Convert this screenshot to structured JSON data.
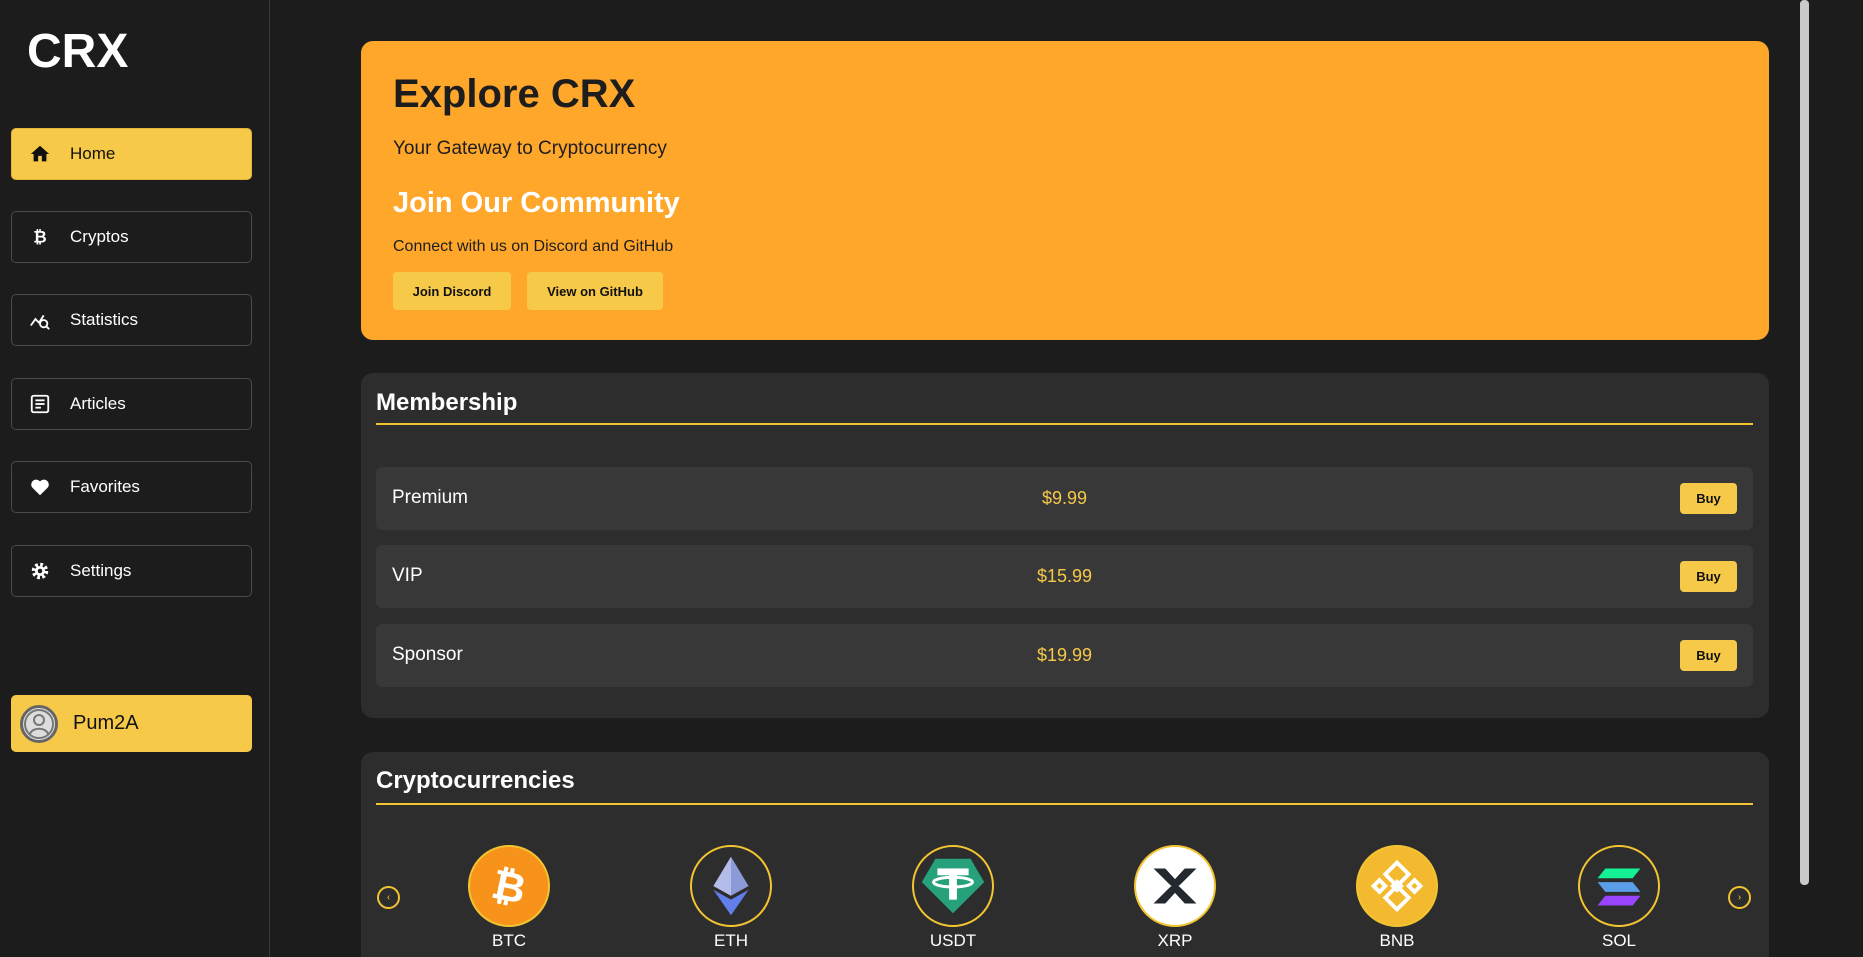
{
  "app": {
    "logo": "CRX"
  },
  "sidebar": {
    "items": [
      {
        "label": "Home",
        "icon": "home-icon",
        "active": true
      },
      {
        "label": "Cryptos",
        "icon": "bitcoin-icon",
        "active": false
      },
      {
        "label": "Statistics",
        "icon": "chart-search-icon",
        "active": false
      },
      {
        "label": "Articles",
        "icon": "article-icon",
        "active": false
      },
      {
        "label": "Favorites",
        "icon": "heart-icon",
        "active": false
      },
      {
        "label": "Settings",
        "icon": "gear-icon",
        "active": false
      }
    ],
    "user": {
      "name": "Pum2A",
      "icon": "user-avatar-icon"
    }
  },
  "hero": {
    "title": "Explore CRX",
    "subtitle": "Your Gateway to Cryptocurrency",
    "community_title": "Join Our Community",
    "community_text": "Connect with us on Discord and GitHub",
    "discord_button": "Join Discord",
    "github_button": "View on GitHub"
  },
  "membership": {
    "title": "Membership",
    "plans": [
      {
        "name": "Premium",
        "price": "$9.99",
        "button": "Buy"
      },
      {
        "name": "VIP",
        "price": "$15.99",
        "button": "Buy"
      },
      {
        "name": "Sponsor",
        "price": "$19.99",
        "button": "Buy"
      }
    ]
  },
  "cryptocurrencies": {
    "title": "Cryptocurrencies",
    "coins": [
      {
        "symbol": "BTC",
        "icon": "bitcoin-logo-icon",
        "color": "#f7931a"
      },
      {
        "symbol": "ETH",
        "icon": "ethereum-logo-icon",
        "color": "#627eea"
      },
      {
        "symbol": "USDT",
        "icon": "tether-logo-icon",
        "color": "#26a17b"
      },
      {
        "symbol": "XRP",
        "icon": "xrp-logo-icon",
        "color": "#23292f"
      },
      {
        "symbol": "BNB",
        "icon": "bnb-logo-icon",
        "color": "#f3ba2f"
      },
      {
        "symbol": "SOL",
        "icon": "solana-logo-icon",
        "color": "#9945ff"
      }
    ]
  },
  "colors": {
    "accent": "#f7c948",
    "hero": "#ffa72b",
    "background": "#1c1c1c",
    "card": "#2d2d2d"
  }
}
